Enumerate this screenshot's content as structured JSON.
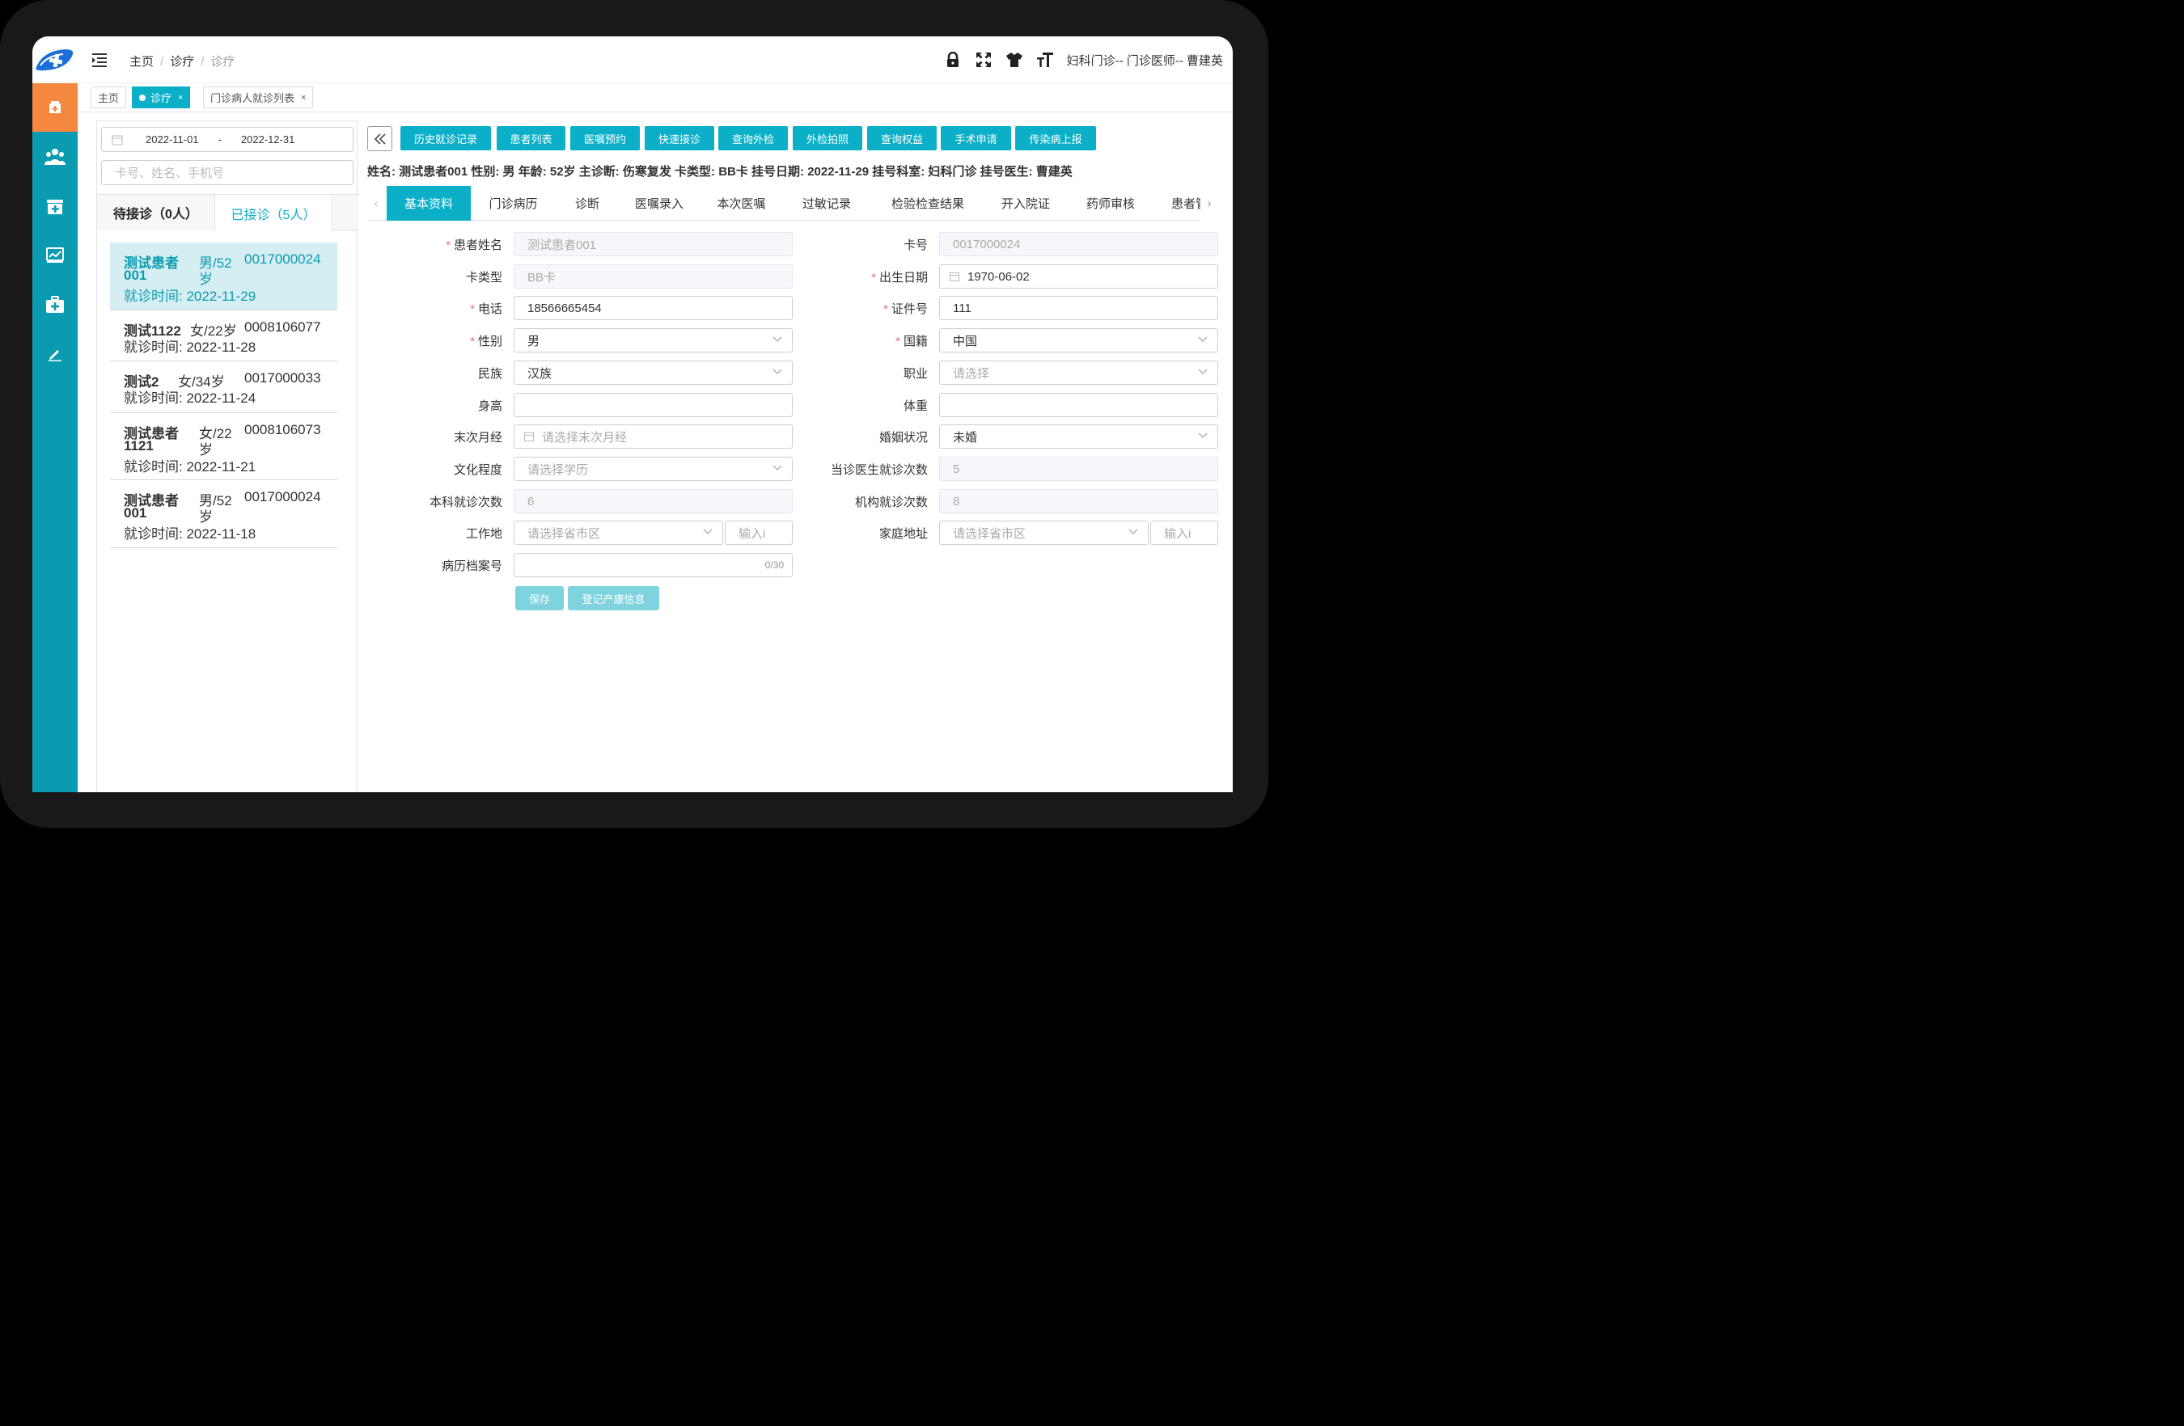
{
  "header": {
    "breadcrumb": [
      "主页",
      "诊疗",
      "诊疗"
    ],
    "user_info": "妇科门诊-- 门诊医师-- 曹建英"
  },
  "page_tabs": [
    {
      "label": "主页",
      "active": false
    },
    {
      "label": "诊疗",
      "active": true
    },
    {
      "label": "门诊病人就诊列表",
      "active": false
    }
  ],
  "left": {
    "date_start": "2022-11-01",
    "date_sep": "-",
    "date_end": "2022-12-31",
    "search_placeholder": "卡号、姓名、手机号",
    "tab_waiting": "待接诊（0人）",
    "tab_done": "已接诊（5人）",
    "patients": [
      {
        "name_l1": "测试患者",
        "name_l2": "001",
        "sex_l1": "男/52",
        "sex_l2": "岁",
        "card": "0017000024",
        "time_label": "就诊时间:",
        "time": "2022-11-29",
        "selected": true
      },
      {
        "name_l1": "测试1122",
        "name_l2": "",
        "sex_l1": "女/22岁",
        "sex_l2": "",
        "card": "0008106077",
        "time_label": "就诊时间:",
        "time": "2022-11-28",
        "selected": false
      },
      {
        "name_l1": "测试2",
        "name_l2": "",
        "sex_l1": "女/34岁",
        "sex_l2": "",
        "card": "0017000033",
        "time_label": "就诊时间:",
        "time": "2022-11-24",
        "selected": false
      },
      {
        "name_l1": "测试患者",
        "name_l2": "1121",
        "sex_l1": "女/22",
        "sex_l2": "岁",
        "card": "0008106073",
        "time_label": "就诊时间:",
        "time": "2022-11-21",
        "selected": false
      },
      {
        "name_l1": "测试患者",
        "name_l2": "001",
        "sex_l1": "男/52",
        "sex_l2": "岁",
        "card": "0017000024",
        "time_label": "就诊时间:",
        "time": "2022-11-18",
        "selected": false
      }
    ]
  },
  "actions": [
    "历史就诊记录",
    "患者列表",
    "医嘱预约",
    "快速接诊",
    "查询外检",
    "外检拍照",
    "查询权益",
    "手术申请",
    "传染病上报"
  ],
  "patient_info": "姓名: 测试患者001  性别: 男  年龄: 52岁  主诊断: 伤寒复发  卡类型: BB卡  挂号日期: 2022-11-29  挂号科室: 妇科门诊  挂号医生: 曹建英",
  "detail_tabs": [
    "基本资料",
    "门诊病历",
    "诊断",
    "医嘱录入",
    "本次医嘱",
    "过敏记录",
    "检验检查结果",
    "开入院证",
    "药师审核",
    "患者管"
  ],
  "form": {
    "name_label": "患者姓名",
    "name_value": "测试患者001",
    "card_label": "卡号",
    "card_value": "0017000024",
    "cardtype_label": "卡类型",
    "cardtype_value": "BB卡",
    "birth_label": "出生日期",
    "birth_value": "1970-06-02",
    "phone_label": "电话",
    "phone_value": "18566665454",
    "idno_label": "证件号",
    "idno_value": "111",
    "sex_label": "性别",
    "sex_value": "男",
    "nation_label": "国籍",
    "nation_value": "中国",
    "ethnic_label": "民族",
    "ethnic_value": "汉族",
    "job_label": "职业",
    "job_placeholder": "请选择",
    "height_label": "身高",
    "height_value": "",
    "weight_label": "体重",
    "weight_value": "",
    "lmp_label": "末次月经",
    "lmp_placeholder": "请选择末次月经",
    "marital_label": "婚姻状况",
    "marital_value": "未婚",
    "edu_label": "文化程度",
    "edu_placeholder": "请选择学历",
    "doctor_visits_label": "当诊医生就诊次数",
    "doctor_visits_value": "5",
    "dept_visits_label": "本科就诊次数",
    "dept_visits_value": "6",
    "org_visits_label": "机构就诊次数",
    "org_visits_value": "8",
    "work_label": "工作地",
    "work_placeholder": "请选择省市区",
    "work_detail_placeholder": "输入i",
    "home_label": "家庭地址",
    "home_placeholder": "请选择省市区",
    "home_detail_placeholder": "输入i",
    "record_label": "病历档案号",
    "record_counter": "0/30",
    "save_label": "保存",
    "maternal_label": "登记产康信息"
  },
  "colors": {
    "accent": "#0bb0c8",
    "sidebar": "#0b9bb0",
    "sidebar_active": "#f5873f",
    "required": "#f56c6c"
  }
}
